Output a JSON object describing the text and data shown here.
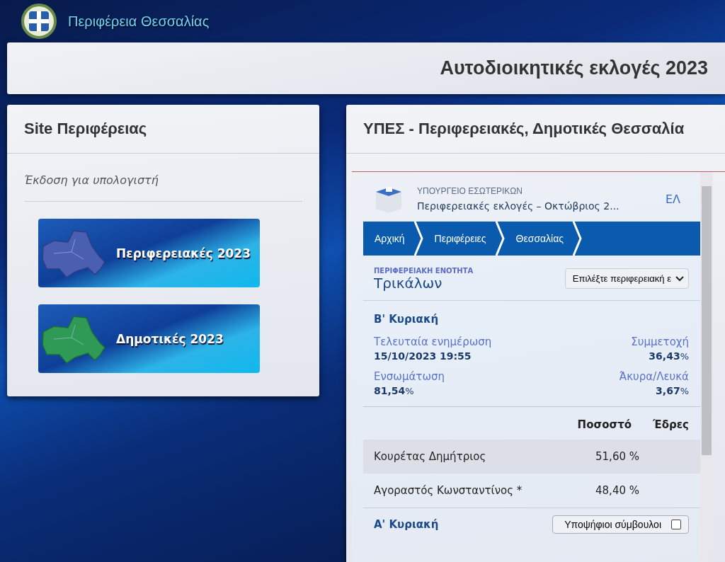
{
  "header": {
    "title": "Περιφέρεια Θεσσαλίας"
  },
  "banner": {
    "title": "Αυτοδιοικητικές εκλογές 2023"
  },
  "site_card": {
    "title": "Site Περιφέρειας",
    "subtitle": "Έκδοση για υπολογιστή",
    "links": [
      {
        "label": "Περιφερειακές 2023",
        "kind": "regional"
      },
      {
        "label": "Δημοτικές 2023",
        "kind": "municipal"
      }
    ]
  },
  "results_card": {
    "title": "ΥΠΕΣ - Περιφερειακές, Δημοτικές Θεσσαλία",
    "ministry": "ΥΠΟΥΡΓΕΙΟ ΕΣΩΤΕΡΙΚΩΝ",
    "election": "Περιφερειακές εκλογές – Οκτώβριος 2...",
    "language": "ΕΛ",
    "breadcrumbs": [
      "Αρχική",
      "Περιφέρειες",
      "Θεσσαλίας"
    ],
    "unit_label": "ΠΕΡΙΦΕΡΕΙΑΚΗ ΕΝΟΤΗΤΑ",
    "unit": "Τρικάλων",
    "unit_select": "Επιλέξτε περιφερειακή ε",
    "round": "Β' Κυριακή",
    "stats": [
      {
        "label": "Τελευταία ενημέρωση",
        "value": "15/10/2023 19:55"
      },
      {
        "label": "Συμμετοχή",
        "value": "36,43",
        "unit": "%"
      },
      {
        "label": "Ενσωμάτωση",
        "value": "81,54",
        "unit": "%"
      },
      {
        "label": "Άκυρα/Λευκά",
        "value": "3,67",
        "unit": "%"
      }
    ],
    "columns": [
      "Ποσοστό",
      "Έδρες"
    ],
    "rows": [
      {
        "name": "Κουρέτας Δημήτριος",
        "percent": "51,60 %",
        "selected": true
      },
      {
        "name": "Αγοραστός Κωνσταντίνος *",
        "percent": "48,40 %",
        "selected": false
      }
    ],
    "first_round": "Α' Κυριακή",
    "candidates_toggle": {
      "label": "Υποψήφιοι σύμβουλοι",
      "checked": false
    }
  }
}
